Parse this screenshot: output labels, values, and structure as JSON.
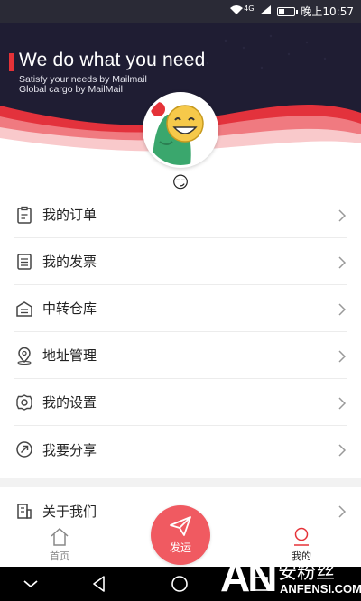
{
  "status_bar": {
    "network": "4G",
    "time": "晚上10:57",
    "battery_level": 0.3
  },
  "banner": {
    "headline": "We do what you need",
    "subline_1": "Satisfy your needs by Mailmail",
    "subline_2": "Global cargo by MailMail",
    "colors": {
      "background": "#1f1d33",
      "accent": "#e53238"
    }
  },
  "profile": {
    "avatar_icon": "cartoon-dinosaur-avatar",
    "nickname": "😏"
  },
  "menu": {
    "items": [
      {
        "label": "我的订单",
        "icon": "clipboard-icon"
      },
      {
        "label": "我的发票",
        "icon": "document-icon"
      },
      {
        "label": "中转仓库",
        "icon": "warehouse-icon"
      },
      {
        "label": "地址管理",
        "icon": "location-pin-icon"
      },
      {
        "label": "我的设置",
        "icon": "settings-gear-icon"
      },
      {
        "label": "我要分享",
        "icon": "share-icon"
      }
    ],
    "secondary_items": [
      {
        "label": "关于我们",
        "icon": "building-icon"
      }
    ]
  },
  "tab_bar": {
    "home_label": "首页",
    "send_label": "发运",
    "me_label": "我的",
    "colors": {
      "send_button": "#f05a61",
      "active": "#222222",
      "inactive": "#888888"
    }
  },
  "watermark": {
    "logo": "AN",
    "chinese": "安粉丝",
    "domain": "ANFENSI.COM"
  }
}
